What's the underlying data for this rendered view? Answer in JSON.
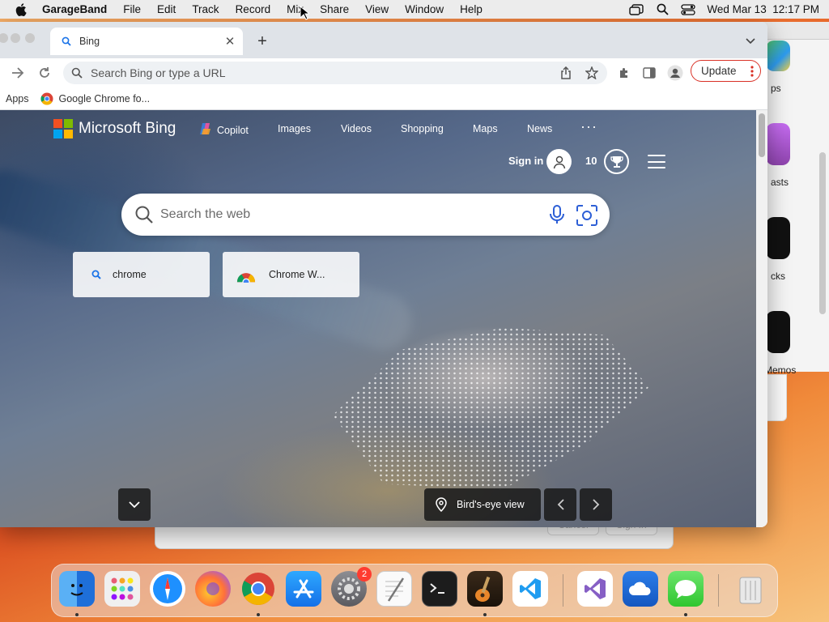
{
  "menubar": {
    "app_name": "GarageBand",
    "items": [
      "File",
      "Edit",
      "Track",
      "Record",
      "Mix",
      "Share",
      "View",
      "Window",
      "Help"
    ],
    "clock": "Wed Mar 13  12:17 PM"
  },
  "background_windows": {
    "side_labels": [
      "ps",
      "asts",
      "cks",
      "Memos"
    ],
    "dialog_buttons": [
      "Cancel",
      "Sign In"
    ]
  },
  "browser": {
    "tab_title": "Bing",
    "omnibox_placeholder": "Search Bing or type a URL",
    "update_label": "Update",
    "bookmarks": [
      "Apps",
      "Google Chrome fo..."
    ]
  },
  "bing": {
    "logo_text": "Microsoft Bing",
    "nav": [
      "Copilot",
      "Images",
      "Videos",
      "Shopping",
      "Maps",
      "News"
    ],
    "more": "···",
    "signin": "Sign in",
    "points": "10",
    "search_placeholder": "Search the web",
    "quick_tiles": [
      "chrome",
      "Chrome W..."
    ],
    "image_caption": "Bird's-eye view"
  },
  "dock": {
    "apps": [
      "finder-icon",
      "launchpad-icon",
      "safari-icon",
      "firefox-icon",
      "chrome-icon",
      "app-store-icon",
      "system-settings-icon",
      "textedit-icon",
      "terminal-icon",
      "garageband-icon",
      "vscode-icon",
      "visual-studio-icon",
      "onedrive-icon",
      "messages-icon",
      "trash-icon"
    ],
    "settings_badge": "2"
  },
  "colors": {
    "update_border": "#d93025",
    "bing_text": "#ffffff",
    "tabstrip": "#dfe3e8"
  }
}
